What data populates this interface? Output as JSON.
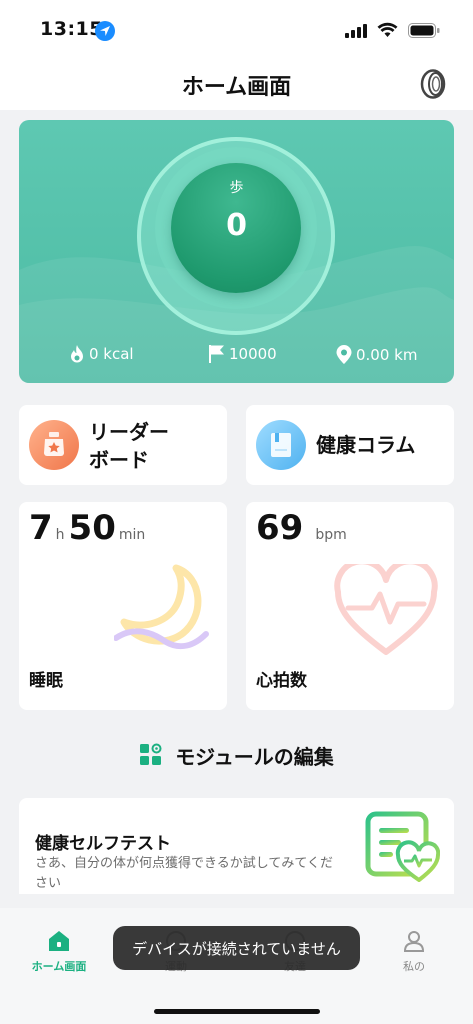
{
  "status_bar": {
    "time": "13:15"
  },
  "header": {
    "title": "ホーム画面"
  },
  "hero": {
    "steps_label": "歩",
    "steps_value": "0",
    "kcal": "0 kcal",
    "goal": "10000",
    "distance": "0.00 km"
  },
  "shortcuts": {
    "leaderboard_line1": "リーダー",
    "leaderboard_line2": "ボード",
    "health_column": "健康コラム"
  },
  "sleep": {
    "hours": "7",
    "hours_unit": "h",
    "minutes": "50",
    "minutes_unit": "min",
    "label": "睡眠"
  },
  "heart_rate": {
    "value": "69",
    "unit": "bpm",
    "label": "心拍数"
  },
  "edit_modules": {
    "label": "モジュールの編集"
  },
  "self_test": {
    "title": "健康セルフテスト",
    "description": "さあ、自分の体が何点獲得できるか試してみてください"
  },
  "tabs": [
    {
      "label": "ホーム画面",
      "active": true
    },
    {
      "label": "運動"
    },
    {
      "label": "友達"
    },
    {
      "label": "私の"
    }
  ],
  "toast": {
    "message": "デバイスが接続されていません"
  },
  "colors": {
    "accent": "#1bb081",
    "hero_bg": "#4cbba3"
  }
}
